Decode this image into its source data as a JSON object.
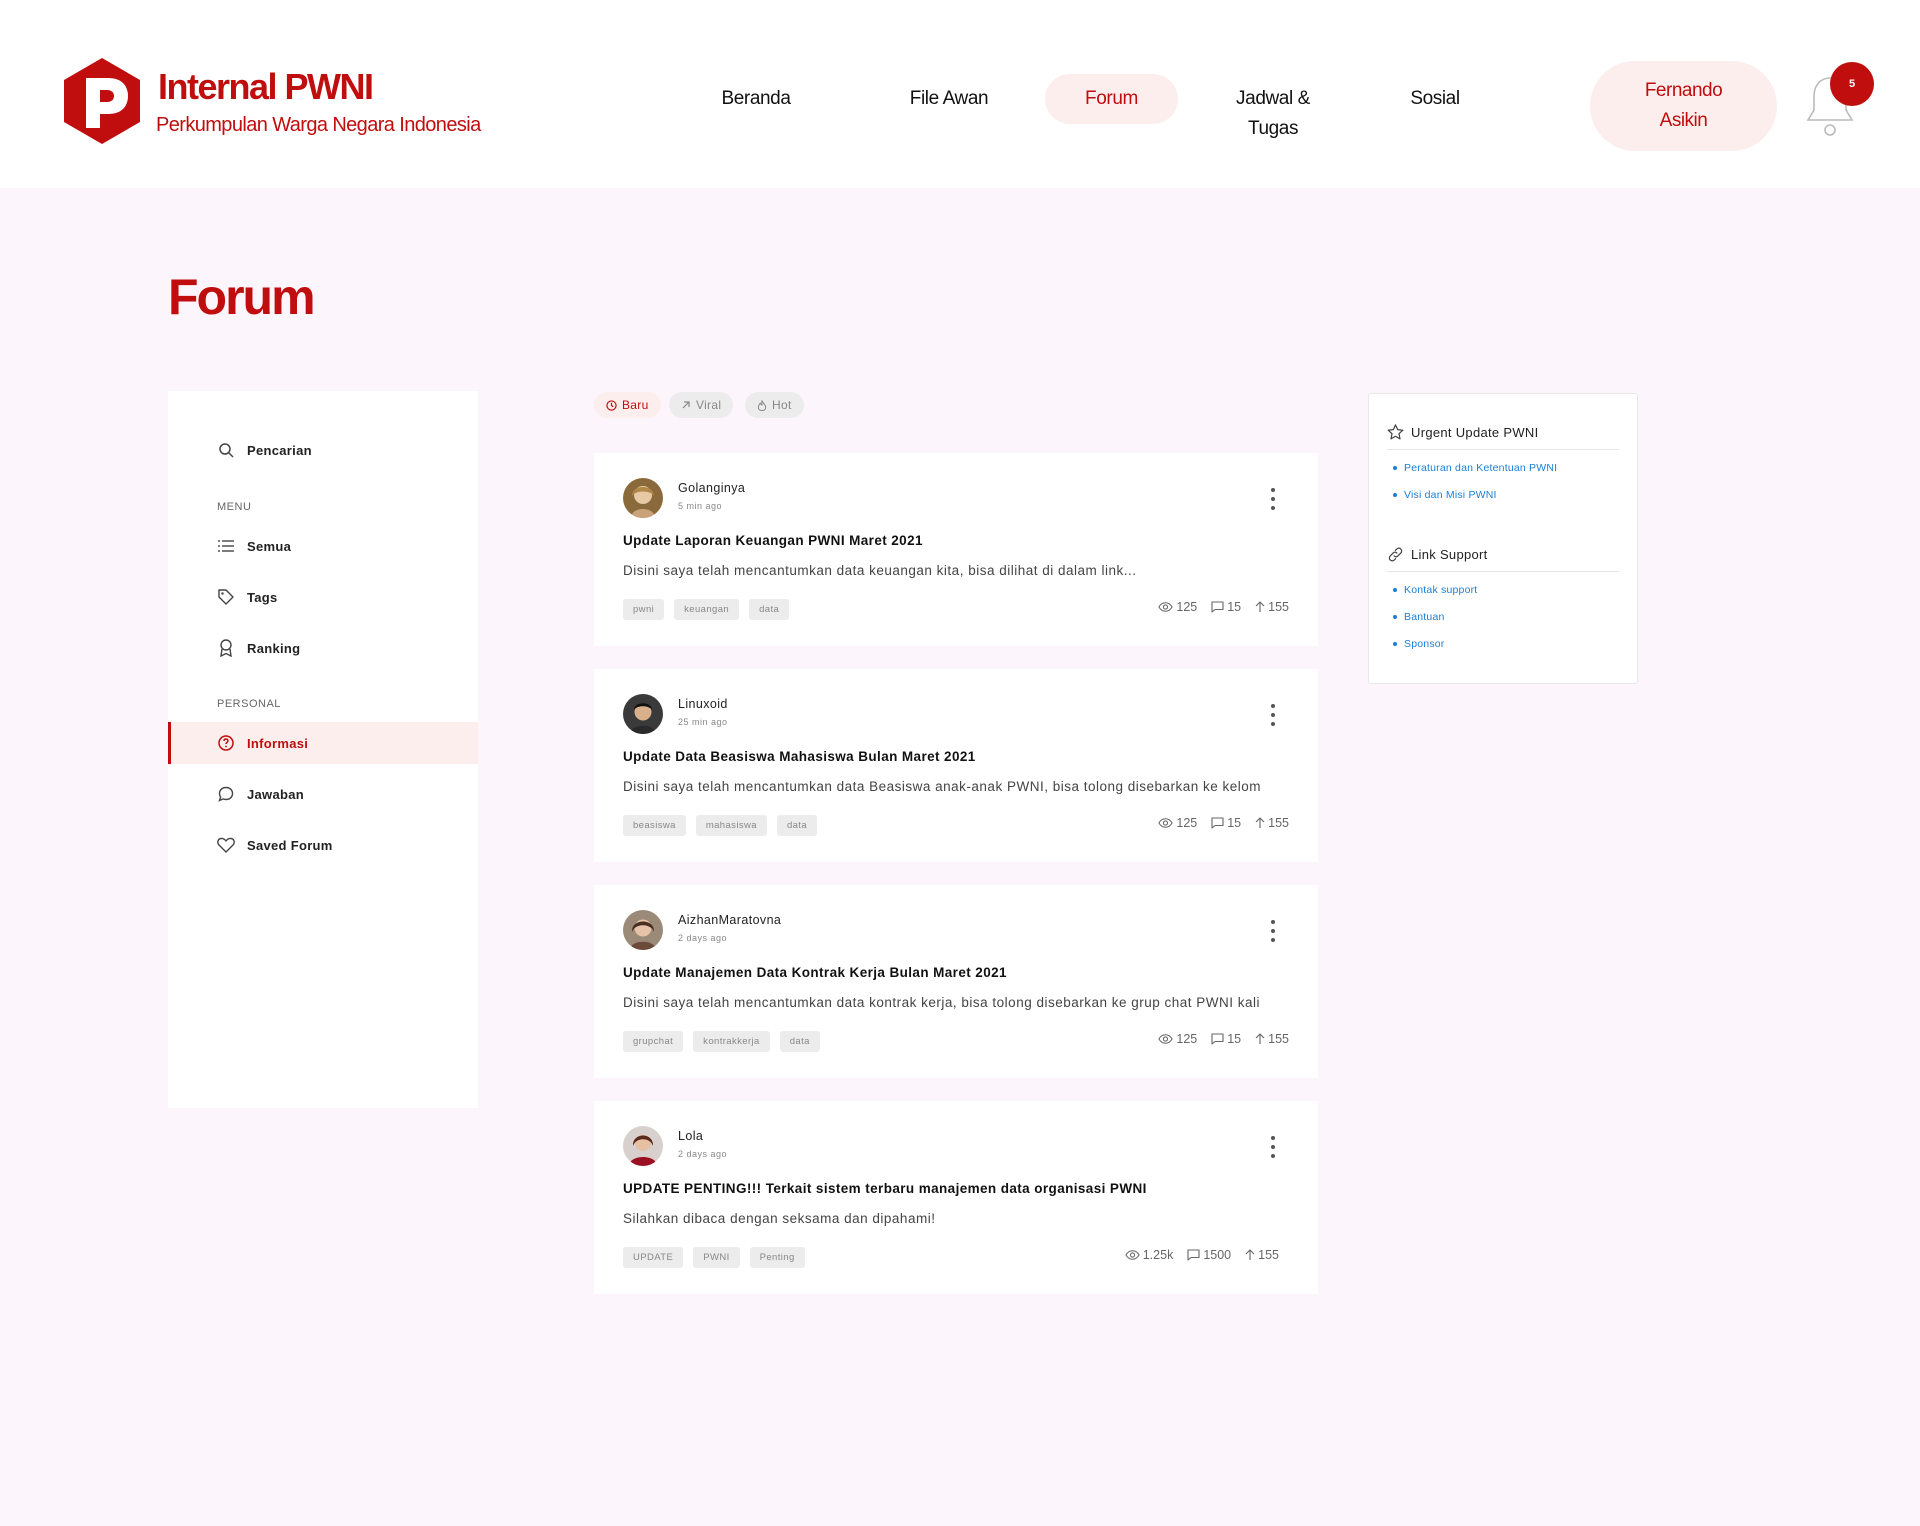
{
  "brand": {
    "title": "Internal PWNI",
    "subtitle": "Perkumpulan Warga Negara Indonesia",
    "accent_color": "#c00d0d"
  },
  "nav": {
    "items": [
      {
        "label": "Beranda"
      },
      {
        "label": "File Awan"
      },
      {
        "label": "Forum",
        "active": true
      },
      {
        "label_line1": "Jadwal &",
        "label_line2": "Tugas"
      },
      {
        "label": "Sosial"
      }
    ]
  },
  "user": {
    "first_name": "Fernando",
    "last_name": "Asikin"
  },
  "notifications": {
    "count": "5",
    "icon": "bell-icon"
  },
  "page": {
    "title": "Forum"
  },
  "sidebar": {
    "search_label": "Pencarian",
    "menu_section": "MENU",
    "menu_items": [
      {
        "label": "Semua",
        "icon": "list-icon"
      },
      {
        "label": "Tags",
        "icon": "tag-icon"
      },
      {
        "label": "Ranking",
        "icon": "award-icon"
      }
    ],
    "personal_section": "PERSONAL",
    "personal_items": [
      {
        "label": "Informasi",
        "icon": "help-circle-icon",
        "active": true
      },
      {
        "label": "Jawaban",
        "icon": "chat-bubble-icon"
      },
      {
        "label": "Saved Forum",
        "icon": "heart-icon"
      }
    ]
  },
  "filters": [
    {
      "label": "Baru",
      "icon": "clock-icon",
      "active": true
    },
    {
      "label": "Viral",
      "icon": "arrow-up-right-icon"
    },
    {
      "label": "Hot",
      "icon": "flame-icon"
    }
  ],
  "posts": [
    {
      "author": "Golanginya",
      "time": "5 min ago",
      "title": "Update Laporan Keuangan PWNI Maret 2021",
      "excerpt": "Disini saya telah mencantumkan data keuangan kita, bisa dilihat di dalam link...",
      "tags": [
        "pwni",
        "keuangan",
        "data"
      ],
      "views": "125",
      "comments": "15",
      "upvotes": "155"
    },
    {
      "author": "Linuxoid",
      "time": "25 min ago",
      "title": "Update Data Beasiswa Mahasiswa Bulan Maret 2021",
      "excerpt": "Disini saya telah mencantumkan data Beasiswa anak-anak PWNI, bisa tolong disebarkan ke kelom",
      "tags": [
        "beasiswa",
        "mahasiswa",
        "data"
      ],
      "views": "125",
      "comments": "15",
      "upvotes": "155"
    },
    {
      "author": "AizhanMaratovna",
      "time": "2 days ago",
      "title": "Update Manajemen Data Kontrak Kerja Bulan Maret 2021",
      "excerpt": "Disini saya telah mencantumkan data kontrak kerja, bisa tolong disebarkan ke grup chat PWNI kali",
      "tags": [
        "grupchat",
        "kontrakkerja",
        "data"
      ],
      "views": "125",
      "comments": "15",
      "upvotes": "155"
    },
    {
      "author": "Lola",
      "time": "2 days ago",
      "title": "UPDATE PENTING!!! Terkait sistem terbaru manajemen data organisasi PWNI",
      "excerpt": "Silahkan dibaca dengan seksama dan dipahami!",
      "tags": [
        "UPDATE",
        "PWNI",
        "Penting"
      ],
      "views": "1.25k",
      "comments": "1500",
      "upvotes": "155"
    }
  ],
  "right_panel": {
    "urgent_title": "Urgent Update PWNI",
    "urgent_links": [
      "Peraturan dan Ketentuan PWNI",
      "Visi dan Misi PWNI"
    ],
    "support_title": "Link Support",
    "support_links": [
      "Kontak support",
      "Bantuan",
      "Sponsor"
    ]
  }
}
